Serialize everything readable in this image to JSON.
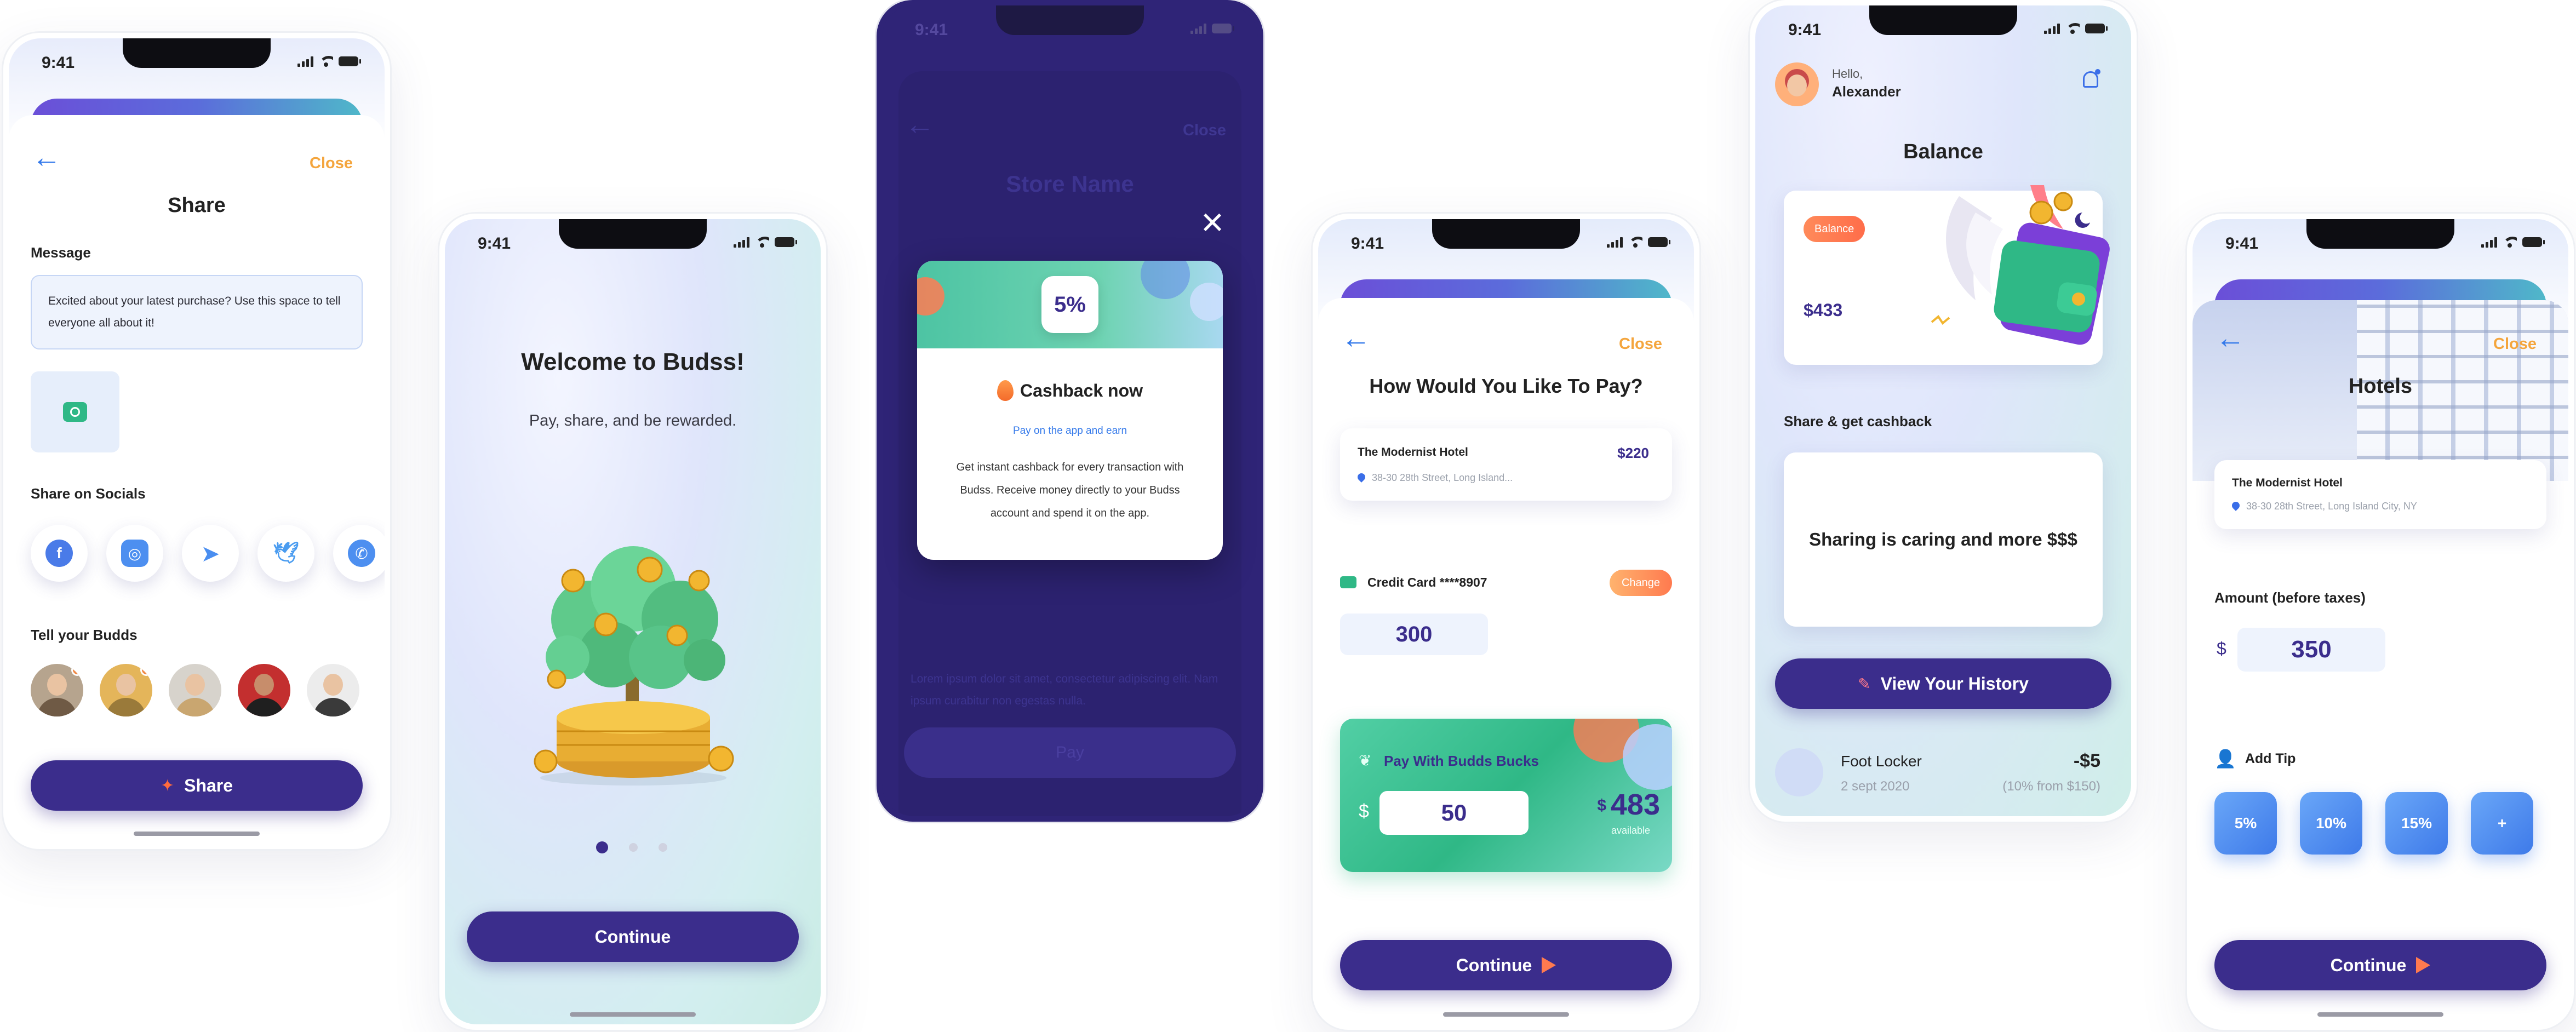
{
  "status": {
    "time": "9:41"
  },
  "share_screen": {
    "back": "←",
    "close": "Close",
    "title": "Share",
    "message_label": "Message",
    "message_text": "Excited about your latest purchase? Use this space to tell everyone all about it!",
    "socials_label": "Share on Socials",
    "socials": [
      "facebook-icon",
      "instagram-icon",
      "telegram-icon",
      "twitter-icon",
      "whatsapp-icon"
    ],
    "budds_label": "Tell your Budds",
    "share_button": "Share"
  },
  "welcome_screen": {
    "title": "Welcome to Budss!",
    "subtitle": "Pay, share, and be rewarded.",
    "continue": "Continue",
    "pages": 3,
    "active_page": 1
  },
  "store_screen": {
    "back": "←",
    "close": "Close",
    "title": "Store Name",
    "body_text": "Lorem ipsum dolor sit amet, consectetur adipiscing elit. Nam ipsum curabitur non egestas nulla.",
    "pay_button": "Pay",
    "modal": {
      "close": "×",
      "percent": "5%",
      "title": "Cashback now",
      "subtitle": "Pay on the app and earn",
      "body": "Get instant cashback for every transaction with Budss. Receive money directly to your Budss account and spend it on the app."
    }
  },
  "pay_screen": {
    "back": "←",
    "close": "Close",
    "title": "How Would You Like To Pay?",
    "hotel_name": "The Modernist Hotel",
    "hotel_price": "$220",
    "hotel_address": "38-30 28th Street, Long Island...",
    "card_label": "Credit Card ****8907",
    "change": "Change",
    "card_amount": "300",
    "bucks_label": "Pay With Budds Bucks",
    "currency": "$",
    "bucks_amount": "50",
    "available_amount": "483",
    "available_label": "available",
    "continue": "Continue"
  },
  "balance_screen": {
    "greeting": "Hello,",
    "user_name": "Alexander",
    "title": "Balance",
    "badge": "Balance",
    "amount": "$433",
    "share_label": "Share & get cashback",
    "share_text": "Sharing is caring and more $$$",
    "history_button": "View Your History",
    "txn_name": "Foot Locker",
    "txn_amount": "-$5",
    "txn_date": "2 sept 2020",
    "txn_note": "(10% from $150)"
  },
  "hotel_screen": {
    "back": "←",
    "close": "Close",
    "title": "Hotels",
    "hotel_name": "The Modernist Hotel",
    "hotel_address": "38-30 28th Street, Long Island City, NY",
    "amount_label": "Amount (before taxes)",
    "currency": "$",
    "amount": "350",
    "tip_label": "Add Tip",
    "tips": [
      "5%",
      "10%",
      "15%",
      "+"
    ],
    "continue": "Continue"
  },
  "colors": {
    "primary": "#3b2d8c",
    "accent_orange": "#f4a53d",
    "link_blue": "#3479ea",
    "green": "#34c38f"
  }
}
